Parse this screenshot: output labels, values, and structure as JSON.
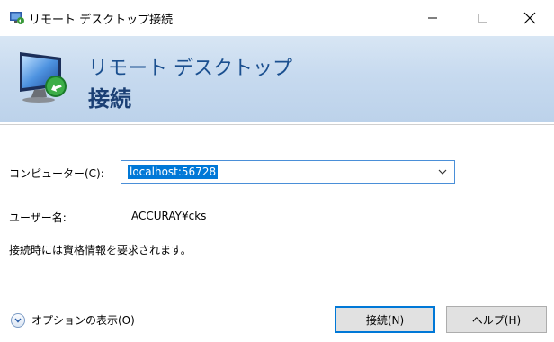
{
  "window": {
    "title": "リモート デスクトップ接続",
    "controls": {
      "minimize_icon": "minimize-icon",
      "maximize_icon": "maximize-icon",
      "close_icon": "close-icon"
    }
  },
  "banner": {
    "line1": "リモート デスクトップ",
    "line2": "接続",
    "icon": "remote-desktop-monitor-icon"
  },
  "form": {
    "computer_label": "コンピューター(C):",
    "computer_value": "localhost:56728",
    "username_label": "ユーザー名:",
    "username_value": "ACCURAY¥cks",
    "info_text": "接続時には資格情報を要求されます。"
  },
  "footer": {
    "options_label": "オプションの表示(O)",
    "connect_label": "接続(N)",
    "help_label": "ヘルプ(H)"
  },
  "colors": {
    "accent": "#0078d7",
    "banner_text": "#1a4f8f",
    "banner_bg": "#c7daef"
  }
}
